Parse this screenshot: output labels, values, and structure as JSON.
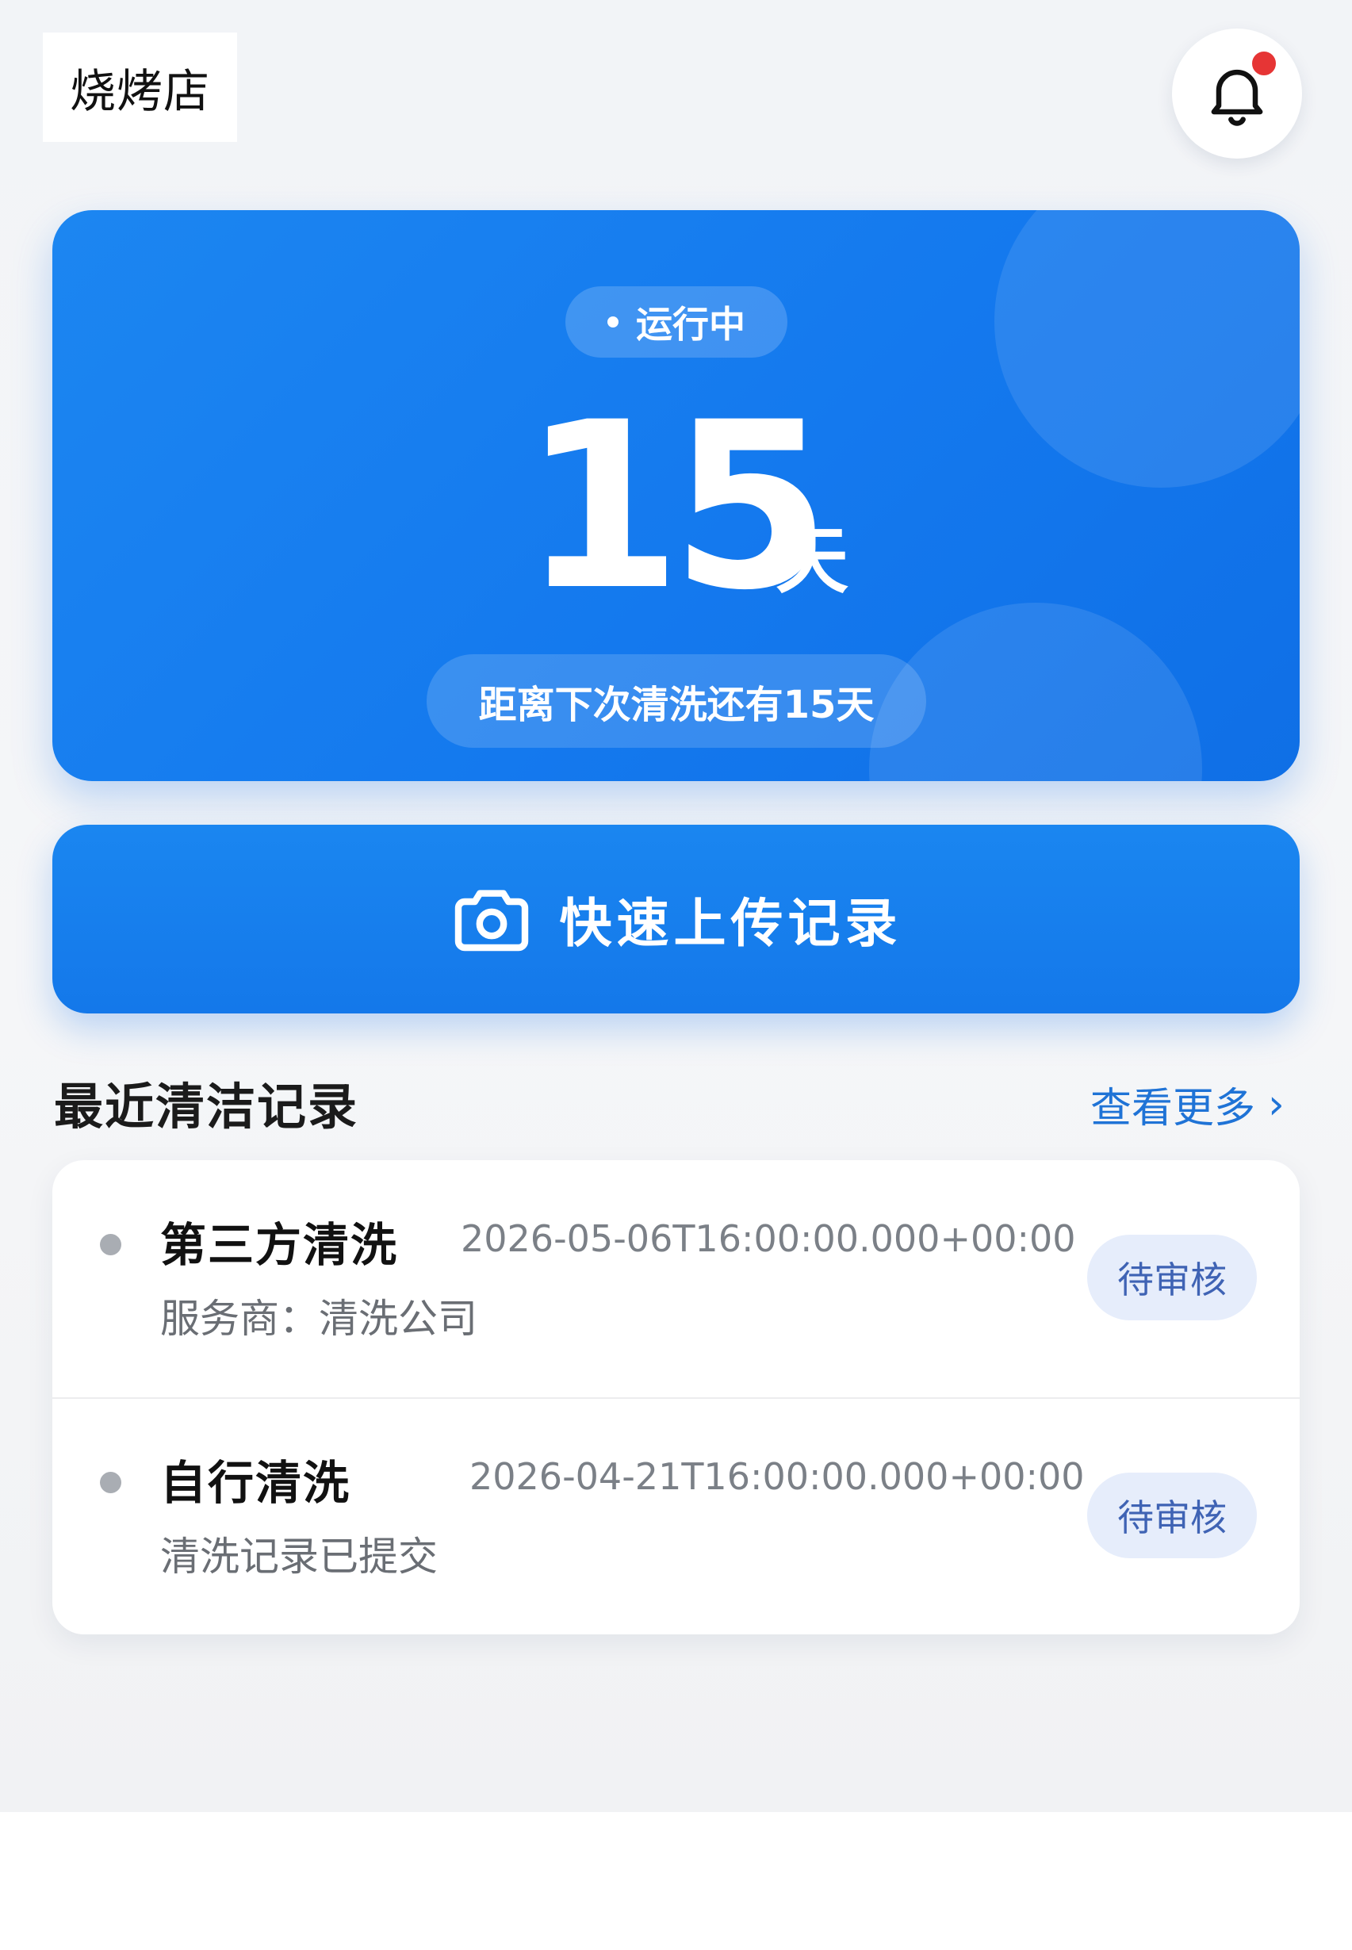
{
  "header": {
    "store_name": "烧烤店",
    "bell_icon": "bell-icon",
    "has_notification": true
  },
  "status_card": {
    "status_label": "运行中",
    "days_value": "15",
    "days_unit": "天",
    "countdown_text": "距离下次清洗还有15天"
  },
  "upload": {
    "label": "快速上传记录",
    "icon": "camera-icon"
  },
  "recent": {
    "title": "最近清洁记录",
    "view_more": "查看更多",
    "items": [
      {
        "title": "第三方清洗",
        "date": "2026-05-06T16:00:00.000+00:00",
        "subtitle": "服务商：清洗公司",
        "status": "待审核"
      },
      {
        "title": "自行清洗",
        "date": "2026-04-21T16:00:00.000+00:00",
        "subtitle": "清洗记录已提交",
        "status": "待审核"
      }
    ]
  },
  "colors": {
    "primary": "#1479ee",
    "link": "#1f73d6",
    "notification": "#e63535",
    "chip_bg": "#e6edfb",
    "chip_text": "#3f63b4"
  }
}
